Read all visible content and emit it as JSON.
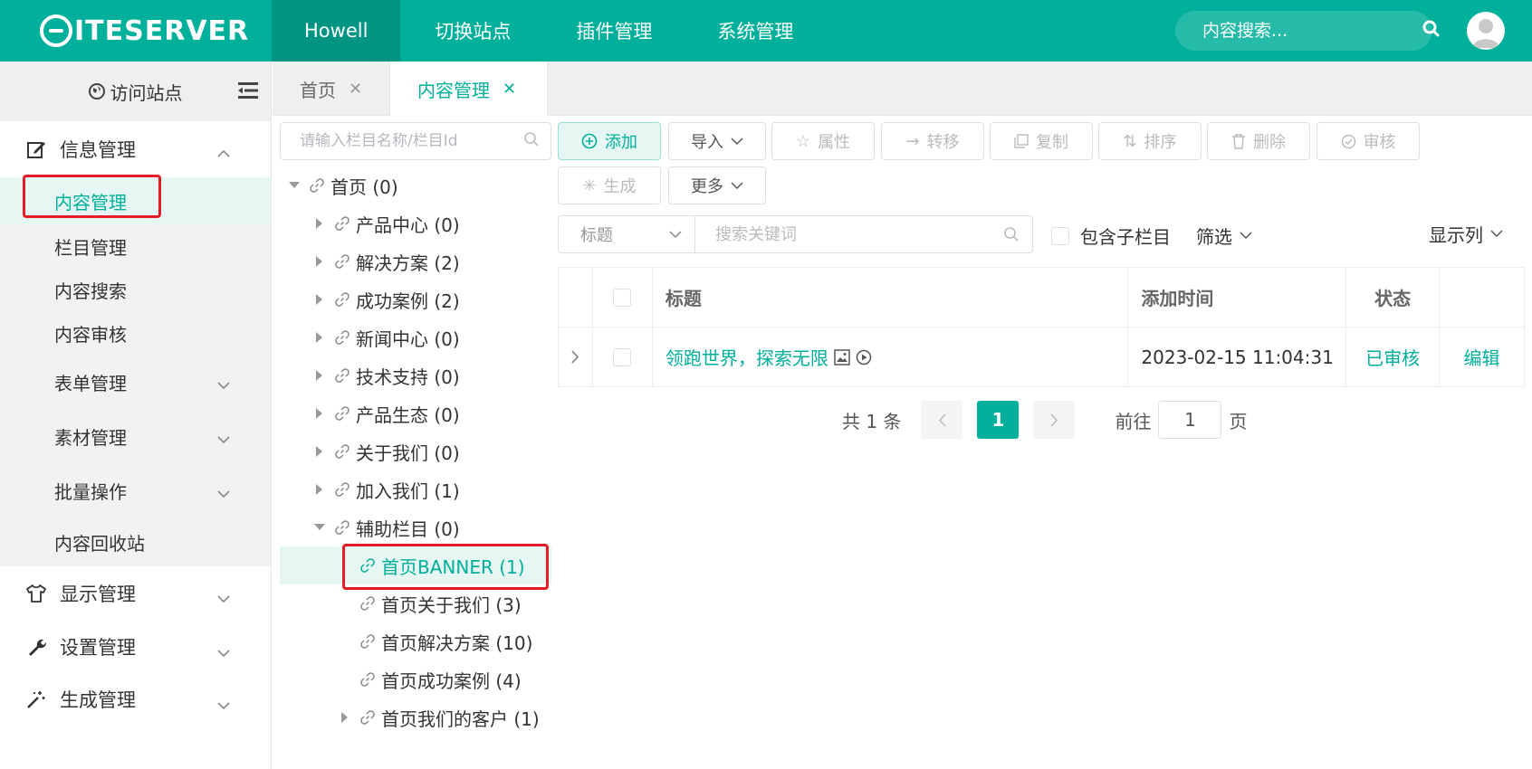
{
  "header": {
    "logo_text": "ITESERVER",
    "nav": [
      "Howell",
      "切换站点",
      "插件管理",
      "系统管理"
    ],
    "search_placeholder": "内容搜索...",
    "accent": "#00b09b"
  },
  "sidebar": {
    "visit_site": "访问站点",
    "groups": [
      {
        "label": "信息管理",
        "icon": "edit-icon"
      },
      {
        "label": "显示管理",
        "icon": "shirt-icon"
      },
      {
        "label": "设置管理",
        "icon": "wrench-icon"
      },
      {
        "label": "生成管理",
        "icon": "magic-wand-icon"
      }
    ],
    "sub_items": [
      "内容管理",
      "栏目管理",
      "内容搜索",
      "内容审核",
      "表单管理",
      "素材管理",
      "批量操作",
      "内容回收站"
    ]
  },
  "tabs": [
    "首页",
    "内容管理"
  ],
  "tree": {
    "search_placeholder": "请输入栏目名称/栏目Id",
    "nodes": [
      {
        "label": "首页 (0)"
      },
      {
        "label": "产品中心 (0)"
      },
      {
        "label": "解决方案 (2)"
      },
      {
        "label": "成功案例 (2)"
      },
      {
        "label": "新闻中心 (0)"
      },
      {
        "label": "技术支持 (0)"
      },
      {
        "label": "产品生态 (0)"
      },
      {
        "label": "关于我们 (0)"
      },
      {
        "label": "加入我们 (1)"
      },
      {
        "label": "辅助栏目 (0)"
      },
      {
        "label": "首页BANNER (1)"
      },
      {
        "label": "首页关于我们 (3)"
      },
      {
        "label": "首页解决方案 (10)"
      },
      {
        "label": "首页成功案例 (4)"
      },
      {
        "label": "首页我们的客户 (1)"
      }
    ]
  },
  "toolbar": {
    "add": "添加",
    "import": "导入",
    "attributes": "属性",
    "move": "转移",
    "copy": "复制",
    "sort": "排序",
    "delete": "删除",
    "review": "审核",
    "generate": "生成",
    "more": "更多"
  },
  "filter": {
    "field": "标题",
    "keyword_placeholder": "搜索关键词",
    "include_children": "包含子栏目",
    "filter_label": "筛选",
    "columns_label": "显示列"
  },
  "table": {
    "headers": [
      "标题",
      "添加时间",
      "状态"
    ],
    "rows": [
      {
        "title": "领跑世界，探索无限",
        "time": "2023-02-15 11:04:31",
        "status": "已审核",
        "action": "编辑"
      }
    ]
  },
  "pagination": {
    "total": "共 1 条",
    "current": "1",
    "goto_prefix": "前往",
    "goto_value": "1",
    "goto_suffix": "页"
  }
}
